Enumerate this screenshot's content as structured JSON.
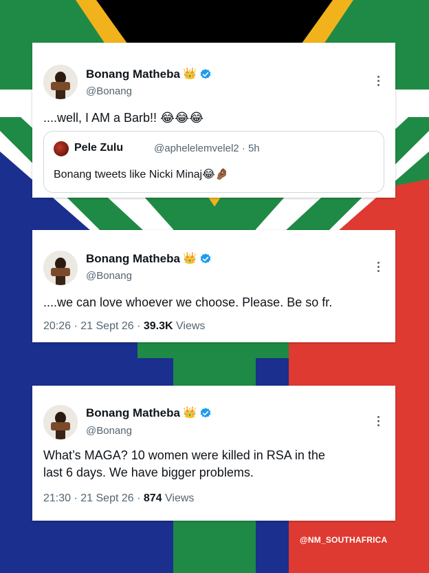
{
  "colors": {
    "flag_green": "#1f8a45",
    "flag_gold": "#f2b21c",
    "flag_red": "#de3a31",
    "flag_blue": "#1b2f8e",
    "flag_black": "#000000",
    "flag_white": "#ffffff",
    "verified_blue": "#1d9bf0",
    "secondary_text": "#536471",
    "primary_text": "#0f1419"
  },
  "tweets": [
    {
      "author": {
        "name": "Bonang Matheba",
        "badge": "👑",
        "handle": "@Bonang",
        "verified_icon": "verified-badge-icon",
        "avatar_icon": "profile-avatar"
      },
      "text": "....well, I AM a Barb!! 😂😂😂",
      "quote": {
        "author_name": "Pele Zulu",
        "author_handle_time": "@aphelelemvelel2 · 5h",
        "text": "Bonang tweets like Nicki Minaj😂🤌🏾"
      }
    },
    {
      "author": {
        "name": "Bonang Matheba",
        "badge": "👑",
        "handle": "@Bonang"
      },
      "text": "....we can love whoever we choose. Please. Be so fr.",
      "meta": {
        "timestamp": "20:26 · 21 Sept 26 · ",
        "views_count": "39.3K",
        "views_label": " Views"
      }
    },
    {
      "author": {
        "name": "Bonang Matheba",
        "badge": "👑",
        "handle": "@Bonang"
      },
      "text_line1": "What’s MAGA? 10 women were killed in RSA in the",
      "text_line2": "last 6 days. We have bigger problems.",
      "meta": {
        "timestamp": "21:30 · 21 Sept 26 · ",
        "views_count": "874",
        "views_label": " Views"
      }
    }
  ],
  "watermark": "@NM_SOUTHAFRICA"
}
